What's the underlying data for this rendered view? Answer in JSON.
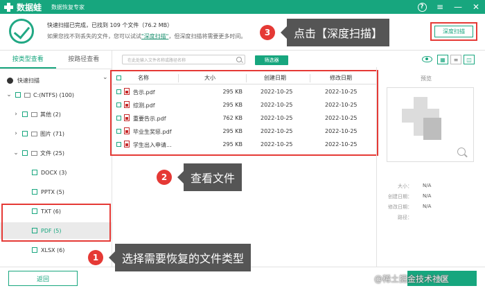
{
  "titlebar": {
    "app_name": "数据蛙",
    "subtitle": "数据恢复专家",
    "help": "?",
    "menu": "≡",
    "minimize": "—",
    "close": "✕"
  },
  "scan": {
    "status_line": "快速扫描已完成，已找到 109 个文件（76.2 MB）",
    "hint_prefix": "如果您找不到丢失的文件，您可以试试",
    "deep_link": "\"深度扫描\"",
    "hint_suffix": "，但深度扫描将需要更多时间。",
    "deep_button": "深度扫描"
  },
  "left": {
    "tabs": [
      "按类型查看",
      "按路径查看"
    ],
    "quick_scan": "快速扫描",
    "tree": [
      {
        "label": "C:(NTFS) (100)"
      },
      {
        "label": "其他 (2)"
      },
      {
        "label": "图片 (71)"
      },
      {
        "label": "文件 (25)"
      },
      {
        "label": "DOCX (3)"
      },
      {
        "label": "PPTX (5)"
      },
      {
        "label": "TXT (6)"
      },
      {
        "label": "PDF (5)"
      },
      {
        "label": "XLSX (6)"
      }
    ]
  },
  "middle": {
    "search_placeholder": "在此处输入文件名称或路径名称",
    "filter_button": "筛选器",
    "columns": {
      "name": "名称",
      "size": "大小",
      "created": "创建日期",
      "modified": "修改日期"
    },
    "files": [
      {
        "name": "告示.pdf",
        "size": "295 KB",
        "created": "2022-10-25",
        "modified": "2022-10-25"
      },
      {
        "name": "综测.pdf",
        "size": "295 KB",
        "created": "2022-10-25",
        "modified": "2022-10-25"
      },
      {
        "name": "重要告示.pdf",
        "size": "762 KB",
        "created": "2022-10-25",
        "modified": "2022-10-25"
      },
      {
        "name": "毕业生奖惩.pdf",
        "size": "295 KB",
        "created": "2022-10-25",
        "modified": "2022-10-25"
      },
      {
        "name": "学生出入申请...",
        "size": "295 KB",
        "created": "2022-10-25",
        "modified": "2022-10-25"
      }
    ]
  },
  "preview": {
    "title": "预览",
    "meta_labels": [
      "大小：",
      "创建日期：",
      "修改日期：",
      "路径："
    ],
    "meta_values": [
      "N/A",
      "N/A",
      "N/A",
      ""
    ]
  },
  "bottom": {
    "back_button": "返回",
    "recover_button": "恢复",
    "watermark": "@稀土掘金技术社区"
  },
  "callouts": {
    "c1": {
      "num": "1",
      "text": "选择需要恢复的文件类型"
    },
    "c2": {
      "num": "2",
      "text": "查看文件"
    },
    "c3": {
      "num": "3",
      "text": "点击【深度扫描】"
    }
  },
  "colors": {
    "accent": "#17a67e",
    "highlight": "#e53935",
    "callout_bg": "#555555"
  }
}
